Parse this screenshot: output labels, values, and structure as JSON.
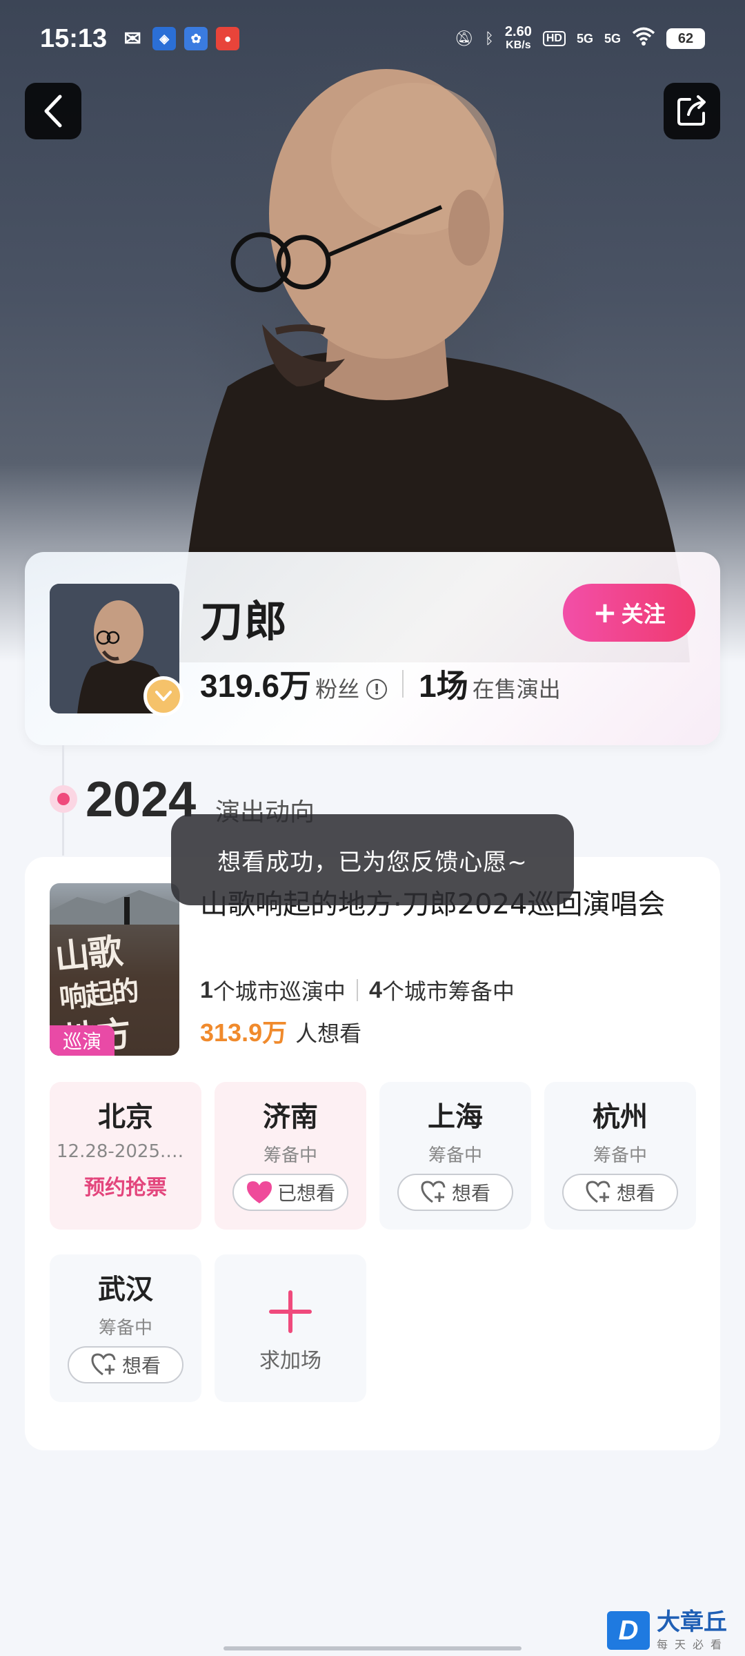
{
  "status_bar": {
    "time": "15:13",
    "speed_value": "2.60",
    "speed_unit": "KB/s",
    "hd_label": "HD",
    "signal1": "5G",
    "signal2": "5G",
    "battery": "62"
  },
  "artist": {
    "name": "刀郎",
    "follow_label": "关注",
    "fans_count": "319.6万",
    "fans_label": "粉丝",
    "shows_count": "1场",
    "shows_label": "在售演出"
  },
  "timeline": {
    "year": "2024",
    "subtitle": "演出动向"
  },
  "toast": "想看成功，已为您反馈心愿~",
  "show": {
    "title": "山歌响起的地方·刀郎2024巡回演唱会",
    "poster_title_line1": "山歌",
    "poster_title_line2": "响起的",
    "poster_title_line3": "地方",
    "poster_tag": "巡演",
    "touring_count": "1",
    "touring_label": "个城市巡演中",
    "planning_count": "4",
    "planning_label": "个城市筹备中",
    "want_count": "313.9万",
    "want_label": "人想看"
  },
  "cities": [
    {
      "name": "北京",
      "status": "12.28-2025.01...",
      "action": "预约抢票"
    },
    {
      "name": "济南",
      "status": "筹备中",
      "action": "已想看"
    },
    {
      "name": "上海",
      "status": "筹备中",
      "action": "想看"
    },
    {
      "name": "杭州",
      "status": "筹备中",
      "action": "想看"
    },
    {
      "name": "武汉",
      "status": "筹备中",
      "action": "想看"
    }
  ],
  "add_city_label": "求加场",
  "watermark": {
    "logo": "D",
    "main": "大章丘",
    "sub": "每天必看"
  },
  "colors": {
    "accent_pink": "#ef4a7c",
    "want_orange": "#f08a2c",
    "badge_gold": "#f5c26a"
  }
}
